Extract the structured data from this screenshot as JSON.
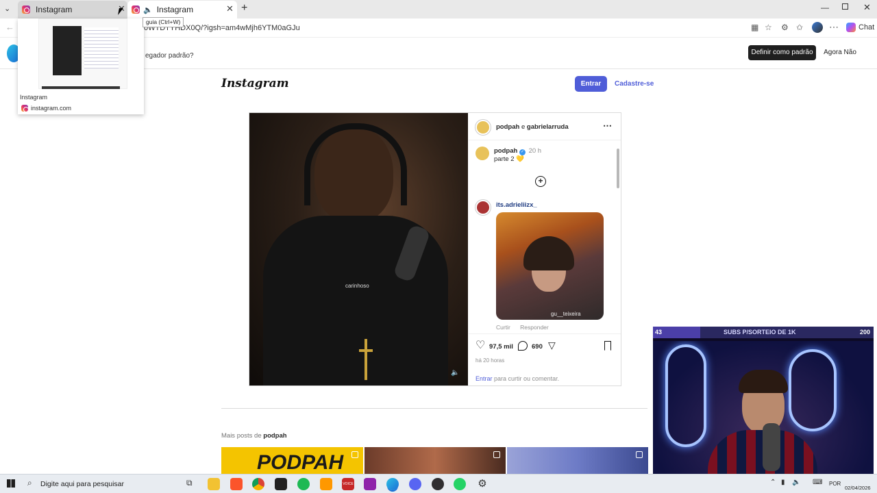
{
  "browser": {
    "tabs": [
      {
        "label": "Instagram",
        "state": "inactive"
      },
      {
        "label": "Instagram",
        "state": "active"
      }
    ],
    "close_tooltip": "guia (Ctrl+W)",
    "tab_preview": {
      "title": "Instagram",
      "url": "instagram.com"
    },
    "address": "0WTDTYHDX0Q/?igsh=am4wMjh6YTM0aGJu",
    "chat_label": "Chat",
    "infobar": {
      "text": "egador padrão?",
      "primary_button": "Definir como padrão",
      "secondary_button": "Agora Não"
    }
  },
  "instagram": {
    "logo": "Instagram",
    "login_button": "Entrar",
    "signup_link": "Cadastre-se",
    "video_overlay_text": "carinhoso",
    "post": {
      "author_main": "podpah",
      "author_connector": "e",
      "author_second": "gabrielarruda",
      "caption_author": "podpah",
      "caption_time": "20 h",
      "caption_text": "parte 2 💛",
      "comment_author": "its.adrieliizx_",
      "comment_image_caption": "gu__teixeira",
      "comment_action_like": "Curtir",
      "comment_action_reply": "Responder",
      "likes": "97,5 mil",
      "comments": "690",
      "time_ago": "há 20 horas",
      "login_prompt_link": "Entrar",
      "login_prompt_text": "para curtir ou comentar."
    },
    "more_posts": {
      "prefix": "Mais posts de",
      "author": "podpah"
    },
    "grid_text": "PODPAH"
  },
  "stream_overlay": {
    "left_count": "43",
    "title": "SUBS P/SORTEIO DE 1K",
    "right_count": "200",
    "progress": 0.215
  },
  "taskbar": {
    "search_placeholder": "Digite aqui para pesquisar",
    "language": "POR",
    "date": "02/04/2026",
    "badge": "VOICE"
  },
  "colors": {
    "accent": "#4f5dd8",
    "tab_strip": "#e9e9e9",
    "overlay_bar": "#4b3fa8"
  }
}
